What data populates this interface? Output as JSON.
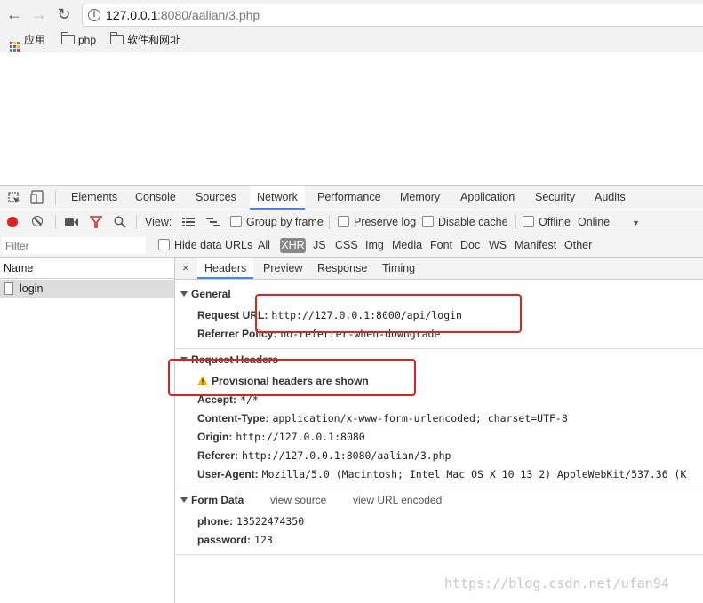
{
  "browser": {
    "url_host": "127.0.0.1",
    "url_rest": ":8080/aalian/3.php",
    "bookmarks": [
      "应用",
      "php",
      "软件和网址"
    ]
  },
  "devtools": {
    "tabs": [
      "Elements",
      "Console",
      "Sources",
      "Network",
      "Performance",
      "Memory",
      "Application",
      "Security",
      "Audits"
    ],
    "active_tab": "Network",
    "toolbar": {
      "view_label": "View:",
      "group_by_frame": "Group by frame",
      "preserve_log": "Preserve log",
      "disable_cache": "Disable cache",
      "offline": "Offline",
      "online": "Online"
    },
    "filter": {
      "placeholder": "Filter",
      "hide_data_urls": "Hide data URLs",
      "types": [
        "All",
        "XHR",
        "JS",
        "CSS",
        "Img",
        "Media",
        "Font",
        "Doc",
        "WS",
        "Manifest",
        "Other"
      ],
      "active_type": "XHR"
    },
    "requests": {
      "name_header": "Name",
      "items": [
        "login"
      ]
    },
    "detail_tabs": [
      "Headers",
      "Preview",
      "Response",
      "Timing"
    ],
    "active_detail_tab": "Headers",
    "general": {
      "title": "General",
      "request_url_key": "Request URL:",
      "request_url": "http://127.0.0.1:8000/api/login",
      "referrer_policy_key": "Referrer Policy:",
      "referrer_policy": "no-referrer-when-downgrade"
    },
    "request_headers": {
      "title": "Request Headers",
      "warning": "Provisional headers are shown",
      "rows": [
        {
          "key": "Accept:",
          "value": "*/*"
        },
        {
          "key": "Content-Type:",
          "value": "application/x-www-form-urlencoded; charset=UTF-8"
        },
        {
          "key": "Origin:",
          "value": "http://127.0.0.1:8080"
        },
        {
          "key": "Referer:",
          "value": "http://127.0.0.1:8080/aalian/3.php"
        },
        {
          "key": "User-Agent:",
          "value": "Mozilla/5.0 (Macintosh; Intel Mac OS X 10_13_2) AppleWebKit/537.36 (K"
        }
      ]
    },
    "form_data": {
      "title": "Form Data",
      "view_source": "view source",
      "view_url_encoded": "view URL encoded",
      "rows": [
        {
          "key": "phone:",
          "value": "13522474350"
        },
        {
          "key": "password:",
          "value": "123"
        }
      ]
    }
  },
  "watermark": "https://blog.csdn.net/ufan94",
  "colors": {
    "accent": "#4285f4",
    "annotation": "#e0231c",
    "record": "#e0231c",
    "filter_icon": "#d93025"
  }
}
